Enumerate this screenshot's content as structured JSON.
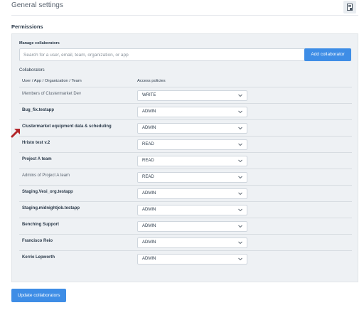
{
  "header": {
    "title": "General settings",
    "icon": "document-icon"
  },
  "section": {
    "title": "Permissions"
  },
  "manage": {
    "label": "Manage collaborators",
    "search_placeholder": "Search for a user, email, team, organization, or app",
    "search_value": "",
    "add_button": "Add collaborator"
  },
  "collaborators": {
    "label": "Collaborators",
    "columns": {
      "user": "User / App / Organization / Team",
      "access": "Access policies"
    },
    "rows": [
      {
        "name_prefix": "Members of ",
        "name": "Clustermarket Dev",
        "access": "WRITE"
      },
      {
        "name": "Bug_fix.testapp",
        "access": "ADMIN"
      },
      {
        "name": "Clustermarket equipment data & scheduling",
        "access": "ADMIN"
      },
      {
        "name": "Hristo test v.2",
        "access": "READ"
      },
      {
        "name": "Project A team",
        "access": "READ"
      },
      {
        "name": "Admins of Project A team",
        "access": "READ"
      },
      {
        "name": "Staging.Vesi_org.testapp",
        "access": "ADMIN"
      },
      {
        "name": "Staging.midnightjob.testapp",
        "access": "ADMIN"
      },
      {
        "name": "Benching Support",
        "access": "ADMIN"
      },
      {
        "name": "Francisco Reio",
        "access": "ADMIN"
      },
      {
        "name": "Kerrie Lepworth",
        "access": "ADMIN"
      }
    ]
  },
  "update_button": "Update collaborators",
  "colors": {
    "accent": "#3e8de6",
    "panel": "#eef1f4",
    "arrow": "#b3262a"
  }
}
